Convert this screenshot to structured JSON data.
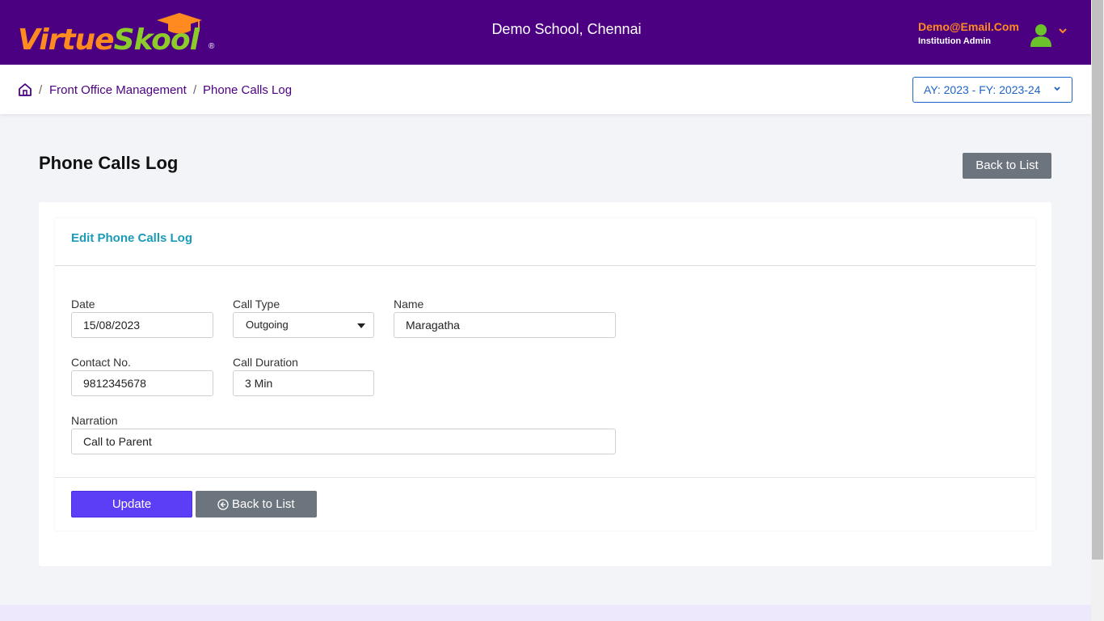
{
  "header": {
    "logo_name": "VirtueSkool",
    "logo_part1": "Virtue",
    "logo_part2": "Skool",
    "logo_reg": "®",
    "school_name": "Demo School, Chennai",
    "user_email": "Demo@Email.Com",
    "user_role": "Institution Admin",
    "colors": {
      "bar": "#4b0082",
      "email": "#ff8a1f",
      "logo_orange": "#ff8a1f",
      "logo_green": "#8ccb2a",
      "avatar": "#6cc22a"
    },
    "icons": {
      "avatar": "user-avatar-icon",
      "menu": "chevron-down-icon"
    }
  },
  "breadcrumb": {
    "icon": "home-icon",
    "separator": "/",
    "items": [
      "Front Office Management",
      "Phone Calls Log"
    ]
  },
  "year_selector": {
    "value": "AY: 2023 - FY: 2023-24",
    "accent": "#1e64c8"
  },
  "page": {
    "title": "Phone Calls Log",
    "back_button": "Back to List"
  },
  "form": {
    "title": "Edit Phone Calls Log",
    "title_color": "#1a9bb8",
    "fields": {
      "date": {
        "label": "Date",
        "value": "15/08/2023"
      },
      "call_type": {
        "label": "Call Type",
        "value": "Outgoing"
      },
      "name": {
        "label": "Name",
        "value": "Maragatha"
      },
      "contact_no": {
        "label": "Contact No.",
        "value": "9812345678"
      },
      "call_duration": {
        "label": "Call Duration",
        "value": "3 Min"
      },
      "narration": {
        "label": "Narration",
        "value": "Call to Parent"
      }
    },
    "update_button": "Update",
    "update_color": "#5b3ef5",
    "back_button": "Back to List"
  }
}
